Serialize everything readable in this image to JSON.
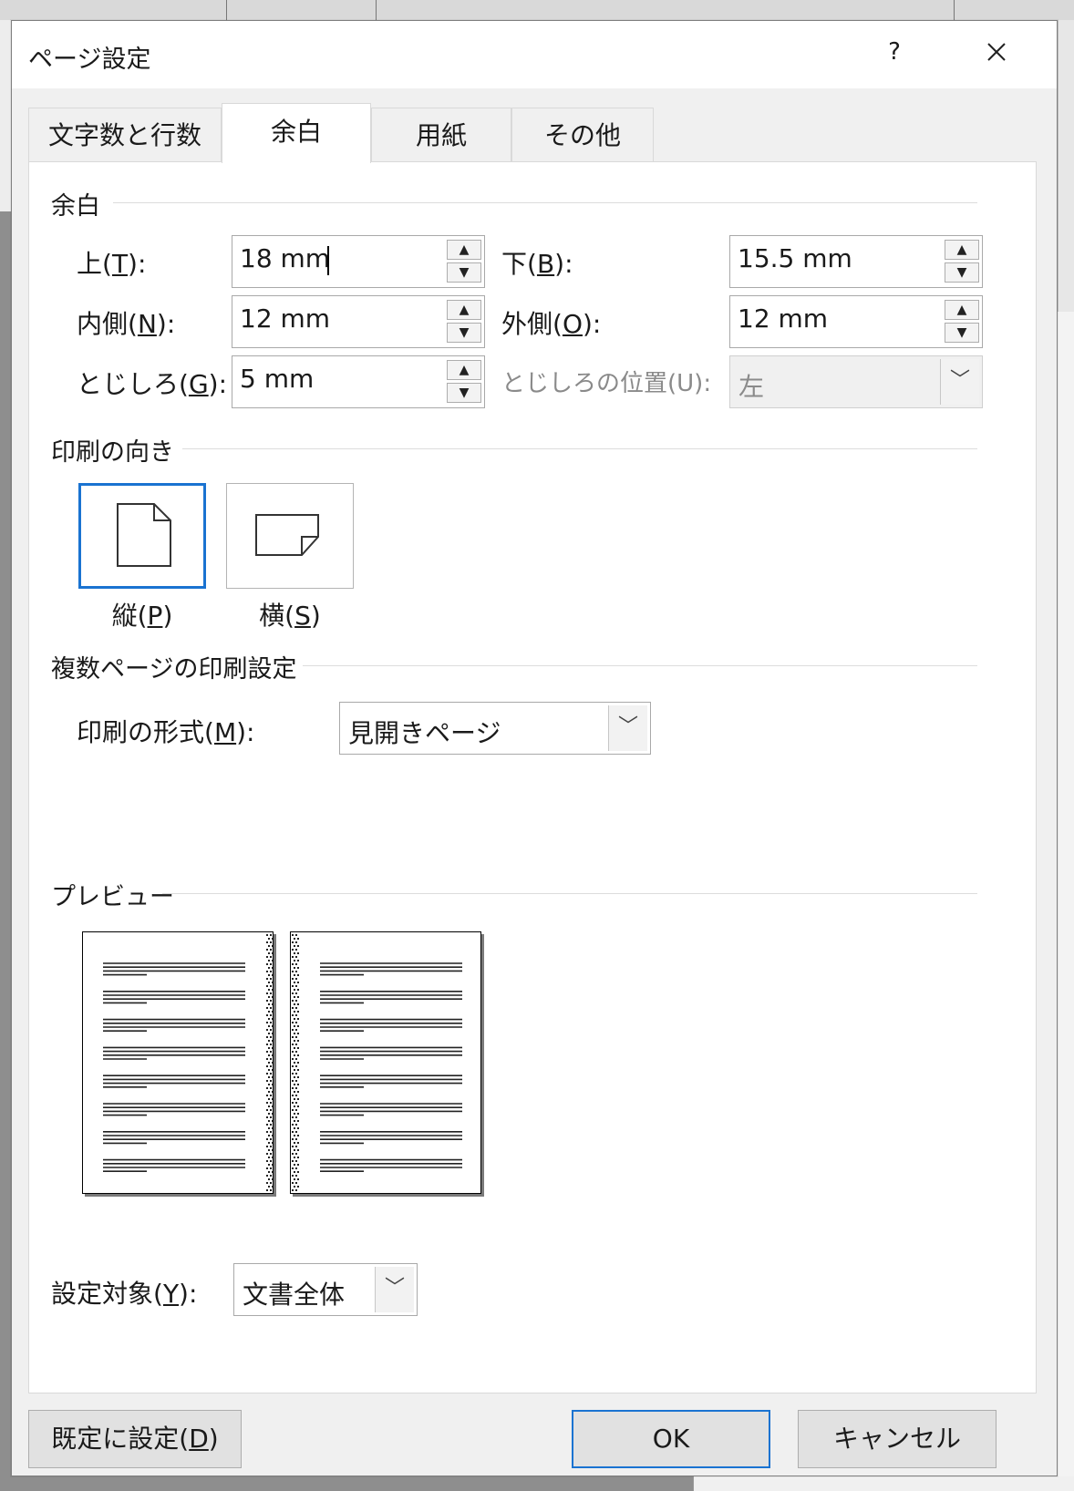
{
  "dialog": {
    "title": "ページ設定",
    "help_label": "?",
    "close_label": "✕"
  },
  "tabs": [
    {
      "label": "文字数と行数"
    },
    {
      "label": "余白"
    },
    {
      "label": "用紙"
    },
    {
      "label": "その他"
    }
  ],
  "margins": {
    "section_title": "余白",
    "top": {
      "label_pre": "上(",
      "mnemonic": "T",
      "label_post": "):",
      "value": "18 mm"
    },
    "bottom": {
      "label_pre": "下(",
      "mnemonic": "B",
      "label_post": "):",
      "value": "15.5 mm"
    },
    "inside": {
      "label_pre": "内側(",
      "mnemonic": "N",
      "label_post": "):",
      "value": "12 mm"
    },
    "outside": {
      "label_pre": "外側(",
      "mnemonic": "O",
      "label_post": "):",
      "value": "12 mm"
    },
    "gutter": {
      "label_pre": "とじしろ(",
      "mnemonic": "G",
      "label_post": "):",
      "value": "5 mm"
    },
    "gutter_position": {
      "label": "とじしろの位置(U):",
      "value": "左"
    },
    "spin_up": "▲",
    "spin_down": "▼"
  },
  "orientation": {
    "section_title": "印刷の向き",
    "portrait": {
      "label_pre": "縦(",
      "mnemonic": "P",
      "label_post": ")",
      "selected": true
    },
    "landscape": {
      "label_pre": "横(",
      "mnemonic": "S",
      "label_post": ")",
      "selected": false
    }
  },
  "multi_page": {
    "section_title": "複数ページの印刷設定",
    "format": {
      "label_pre": "印刷の形式(",
      "mnemonic": "M",
      "label_post": "):",
      "value": "見開きページ"
    }
  },
  "preview": {
    "section_title": "プレビュー"
  },
  "apply_to": {
    "label_pre": "設定対象(",
    "mnemonic": "Y",
    "label_post": "):",
    "value": "文書全体"
  },
  "dropdown_glyph": "﹀",
  "buttons": {
    "set_default": {
      "label_pre": "既定に設定(",
      "mnemonic": "D",
      "label_post": ")"
    },
    "ok": "OK",
    "cancel": "キャンセル"
  },
  "colors": {
    "accent": "#1a73d1",
    "dialog_bg": "#f0f0f0",
    "panel_bg": "#ffffff"
  }
}
